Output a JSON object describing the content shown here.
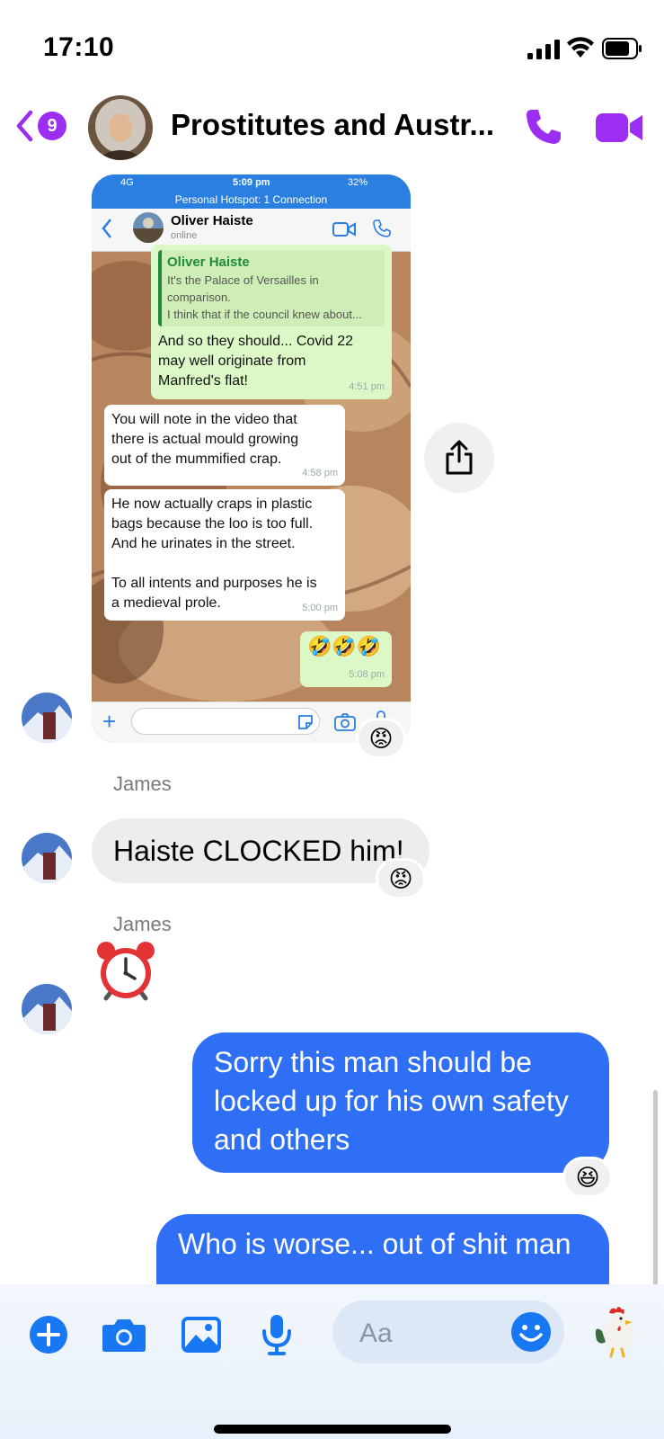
{
  "status_bar": {
    "time": "17:10"
  },
  "header": {
    "unread_count": "9",
    "title": "Prostitutes and Austr...",
    "accent_color": "#9b2ef0"
  },
  "shared_screenshot": {
    "status": {
      "network": "4G",
      "time": "5:09 pm",
      "battery": "32%"
    },
    "hotspot": "Personal Hotspot: 1 Connection",
    "contact_name": "Oliver Haiste",
    "contact_status": "online",
    "messages": [
      {
        "direction": "out",
        "quote_name": "Oliver Haiste",
        "quote_lines": [
          "It's the Palace of Versailles in",
          "comparison.",
          "I think that if the council knew about..."
        ],
        "lines": [
          "And so they should... Covid 22",
          "may well originate from",
          "Manfred's flat!"
        ],
        "time": "4:51 pm"
      },
      {
        "direction": "in",
        "lines": [
          "You will note in the video that",
          "there is actual mould growing",
          "out of the mummified crap."
        ],
        "time": "4:58 pm"
      },
      {
        "direction": "in",
        "lines": [
          "He now actually craps in plastic",
          "bags because the loo is too full.",
          "And he urinates in the street.",
          "",
          "To all intents and purposes he is",
          "a medieval prole."
        ],
        "time": "5:00 pm"
      },
      {
        "direction": "out",
        "emoji": "🤣🤣🤣",
        "time": "5:08 pm"
      }
    ]
  },
  "reactions": {
    "screenshot": "😡",
    "clocked": "😡",
    "sorry": "😆"
  },
  "messages": [
    {
      "sender": "James",
      "text": "Haiste CLOCKED him!"
    },
    {
      "sender": "James",
      "icon": "alarm-clock-emoji"
    },
    {
      "text": "Sorry this man should be locked up for his own safety and others",
      "lines": [
        "Sorry this man should be",
        "locked up for his own safety",
        "and others"
      ]
    },
    {
      "text": "Who is worse... out of shit man"
    }
  ],
  "composer": {
    "placeholder": "Aa"
  },
  "colors": {
    "outgoing_bubble": "#2f6ff5",
    "incoming_bubble": "#ededed",
    "composer_icons": "#1877f2"
  }
}
